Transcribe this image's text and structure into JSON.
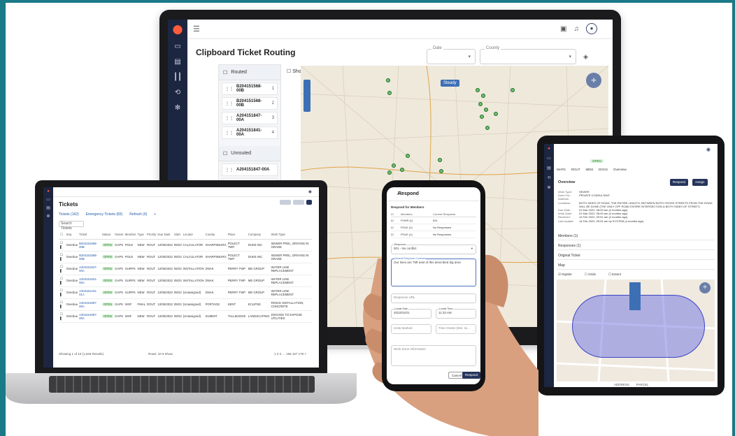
{
  "monitor": {
    "title": "Clipboard Ticket Routing",
    "field_date_label": "Date",
    "field_county_label": "County",
    "routed_label": "Routed",
    "show_details_label": "Show Details",
    "unrouted_label": "Unrouted",
    "map_chip": "Steady",
    "routed": [
      {
        "id": "B204151568-00B",
        "n": "1"
      },
      {
        "id": "B204151568-00B",
        "n": "2"
      },
      {
        "id": "A204151847-00A",
        "n": "3"
      },
      {
        "id": "A204151841-00A",
        "n": "4"
      }
    ],
    "unrouted": [
      {
        "id": "A204151847-00A"
      },
      {
        "id": "A204151341-01A"
      },
      {
        "id": "A204151867-00A"
      }
    ]
  },
  "laptop": {
    "title": "Tickets",
    "tabs": [
      "Tickets (162)",
      "Emergency Tickets (83)",
      "Refresh (0)",
      "+"
    ],
    "search": "Search Tickets",
    "columns": [
      "",
      "",
      "Seq",
      "Ticket",
      "Status",
      "Owner",
      "Member",
      "Type",
      "Priority",
      "Due Date",
      "Start",
      "Locator",
      "County",
      "Place",
      "Company",
      "Work Type"
    ],
    "rows": [
      [
        "Overdue",
        "B204151568-00B",
        "OPEN",
        "GAPS",
        "POLE",
        "NEW",
        "ROUT",
        "12/05/2022",
        "09/23",
        "CALCULATOR",
        "SHARPSBURG",
        "POLECT TWP",
        "DUKE INC",
        "SEWER PREL, DRIVING IN GRADE"
      ],
      [
        "Overdue",
        "B204151568-00B",
        "OPEN",
        "GAPS",
        "POLE",
        "NEW",
        "ROUT",
        "12/05/2022",
        "09/23",
        "CALCULATOR",
        "SHARPSBURG",
        "POLECT TWP",
        "DUKE INC",
        "SEWER PREL, DRIVING IN GRADE"
      ],
      [
        "Overdue",
        "A204151847-00A",
        "OPEN",
        "GAPS",
        "SURPS",
        "NEW",
        "ROUT",
        "12/05/2022",
        "09/23",
        "INSTALLATION",
        "DNAK",
        "PERRY TWP",
        "ME GROUP",
        "WATER LINE REPLACEMENT"
      ],
      [
        "Overdue",
        "A204151841-00A",
        "OPEN",
        "GAPS",
        "SURPS",
        "NEW",
        "ROUT",
        "12/05/2022",
        "09/23",
        "INSTALLATION",
        "DNAK",
        "PERRY TWP",
        "ME GROUP",
        "WATER LINE REPLACEMENT"
      ],
      [
        "Overdue",
        "A204151341-01A",
        "OPEN",
        "GAPS",
        "SURPS",
        "NEW",
        "ROUT",
        "12/05/2022",
        "09/23",
        "(Unassigned)",
        "DNAK",
        "PERRY TWP",
        "ME GROUP",
        "WATER LINE REPLACEMENT"
      ],
      [
        "Overdue",
        "A204151867-00A",
        "OPEN",
        "GAPS",
        "WSF",
        "FMAL",
        "ROUT",
        "12/05/2022",
        "09/23",
        "(Unassigned)",
        "PORTAGE",
        "KENT",
        "ECLIPSE",
        "FENCE INSTALLATION, CONCRETE"
      ],
      [
        "Overdue",
        "A204151867-00A",
        "OPEN",
        "GAPS",
        "WSF",
        "NEW",
        "ROUT",
        "12/05/2022",
        "09/23",
        "(Unassigned)",
        "SUMMIT",
        "TALLMADGE",
        "LANDSCAPING",
        "DIGGING TO EXPOSE UTILITIES"
      ]
    ],
    "footer": "Showing 1 of 10 (1,646 Results)",
    "rows_label": "Rows: 10 ▾ Show",
    "pager": "1 2 3 …  156  157  178  >"
  },
  "tablet": {
    "status_chip": "OPEN",
    "tabs": [
      "MAPS",
      "ROUT",
      "MEM",
      "DOCS",
      "Overview"
    ],
    "overview": "Overview",
    "respond": "Respond",
    "assign": "Assign",
    "fields": [
      [
        "Work Type:",
        "SEWER"
      ],
      [
        "Done For:",
        "PRIVATE CONSULTANT"
      ],
      [
        "Address:",
        ""
      ],
      [
        "Locations:",
        "BOTH SIDES OF ROAD, THE ENTIRE LENGTH, BETWEEN BOTH CROSS STREETS FROM THE ROAD WILL BE DONE (THE ONLY OFF ROAD ENTIRE INTERSECTION & BOTH SIDES OF STREET)"
      ],
      [
        "Due Date:",
        "01 Mar 2022, 08:00 am (4 months ago)"
      ],
      [
        "Work Date:",
        "01 Mar 2022, 08:00 am (4 months ago)"
      ],
      [
        "Received:",
        "14 Feb 2022, 09:51 am (4 months ago)"
      ],
      [
        "Last Update:",
        "14 Feb 2022, 09:51 am by SYSTEM (4 months ago)"
      ]
    ],
    "sections": [
      "Members (1)",
      "Responses (1)",
      "Original Ticket",
      "Map"
    ],
    "map_toggles": [
      "DigSite",
      "Grids",
      "Extent"
    ],
    "bottom_labels": [
      "ADDRESS",
      "PARCEL"
    ]
  },
  "phone": {
    "title": "Respond",
    "respond_for_members": "Respond for Members",
    "col_members": "Members",
    "col_current": "Current Response",
    "members": [
      {
        "name": "FOHR (1)",
        "resp": "001"
      },
      {
        "name": "POLE (1)",
        "resp": "No Responses"
      },
      {
        "name": "POLE (1)",
        "resp": "No Responses"
      }
    ],
    "response_label": "Response",
    "response_value": "001 - No conflict",
    "comment_label": "General Response Comment",
    "comment_value": "Our lines are 75ft east of this described dig area",
    "url_placeholder": "Response URL",
    "date_label": "Locate Date",
    "date_value": "2022/01/01",
    "time_label": "Locate Time",
    "time_value": "11:33 AM",
    "marked_placeholder": "Units Marked",
    "onsite_placeholder": "Time Onsite (Min: ss...",
    "info_placeholder": "Work Done information",
    "cancel": "Cancel",
    "respond_btn": "Respond"
  }
}
